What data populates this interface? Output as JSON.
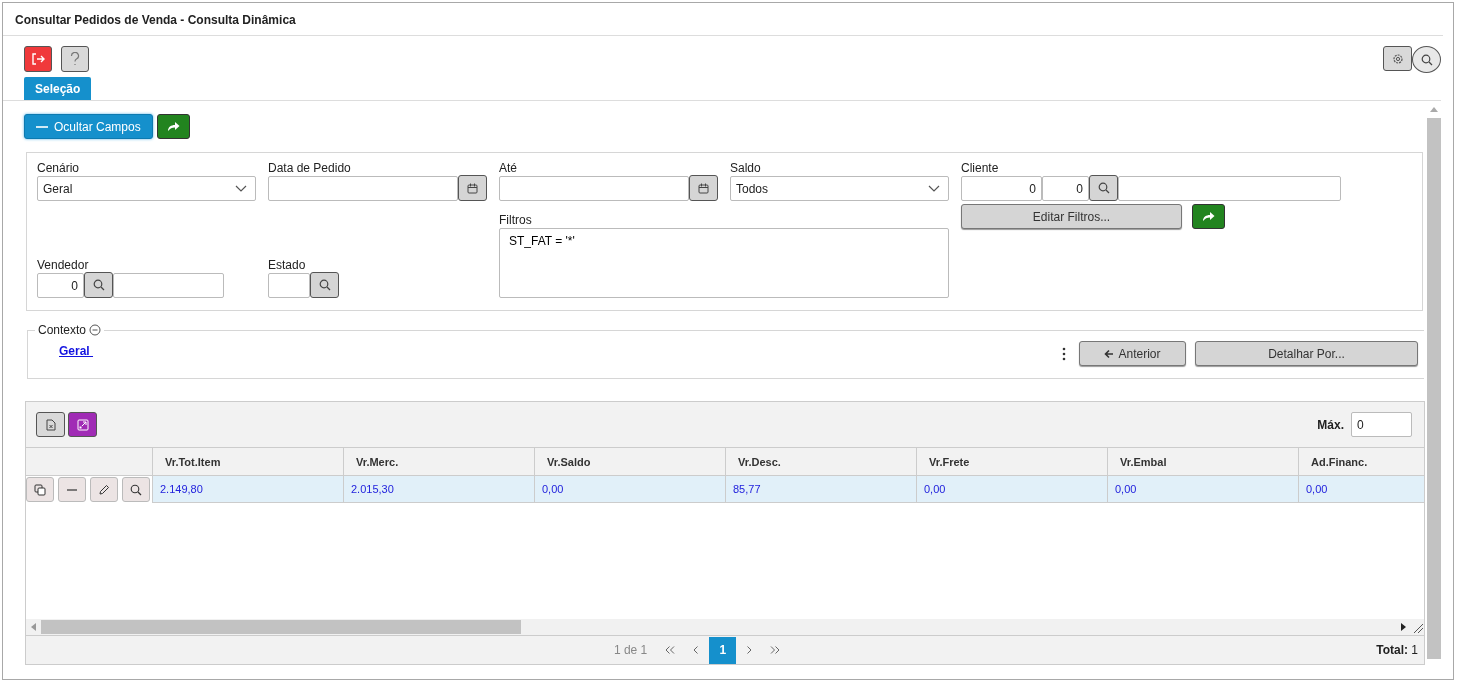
{
  "window": {
    "title": "Consultar Pedidos de Venda - Consulta Dinâmica"
  },
  "tabs": [
    {
      "label": "Seleção",
      "selected": true
    }
  ],
  "toggle_fields_button": "Ocultar Campos",
  "filters": {
    "cenario": {
      "label": "Cenário",
      "value": "Geral"
    },
    "data_pedido": {
      "label": "Data de Pedido"
    },
    "ate": {
      "label": "Até"
    },
    "saldo": {
      "label": "Saldo",
      "value": "Todos"
    },
    "cliente": {
      "label": "Cliente",
      "code": "0",
      "branch": "0"
    },
    "filtros": {
      "label": "Filtros",
      "value": "ST_FAT = '*'"
    },
    "edit_filters_button": "Editar Filtros...",
    "vendedor": {
      "label": "Vendedor",
      "code": "0"
    },
    "estado": {
      "label": "Estado"
    }
  },
  "context": {
    "legend": "Contexto",
    "link": "Geral",
    "previous_button": "Anterior",
    "detail_button": "Detalhar Por..."
  },
  "grid": {
    "max_label": "Máx.",
    "max_value": "0",
    "columns": [
      "Vr.Tot.Item",
      "Vr.Merc.",
      "Vr.Saldo",
      "Vr.Desc.",
      "Vr.Frete",
      "Vr.Embal",
      "Ad.Financ."
    ],
    "rows": [
      {
        "selected": true,
        "cells": [
          "2.149,80",
          "2.015,30",
          "0,00",
          "85,77",
          "0,00",
          "0,00",
          "0,00"
        ]
      }
    ]
  },
  "pager": {
    "summary": "1 de 1",
    "pages": [
      {
        "label": "1",
        "selected": true
      }
    ],
    "total": "**Total:** 1"
  }
}
